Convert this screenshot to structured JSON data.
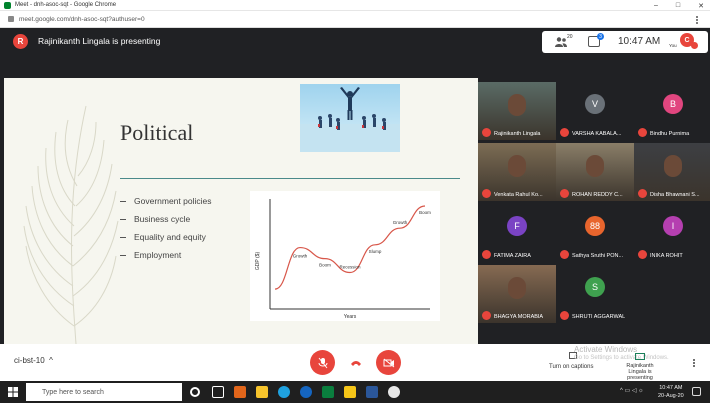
{
  "browser": {
    "tab_title": "Meet - dnh-asoc-sqt - Google Chrome",
    "url": "meet.google.com/dnh-asoc-sqt?authuser=0",
    "window_controls": [
      "–",
      "□",
      "✕"
    ]
  },
  "meet": {
    "presenter_initial": "R",
    "presenter_text": "Rajinikanth Lingala is presenting",
    "people_count": "20",
    "chat_badge": "3",
    "clock": "10:47 AM",
    "you_label": "You",
    "you_initial": "C",
    "meeting_code": "ci-bst-10",
    "meeting_code_chevron": "^",
    "captions_label": "Turn on captions",
    "activate_line1": "Activate Windows",
    "activate_line2": "Go to Settings to activate Windows.",
    "presenting_label": "Rajinikanth Lingala is presenting"
  },
  "slide": {
    "title": "Political",
    "bullets": [
      "Government policies",
      "Business cycle",
      "Equality and equity",
      "Employment"
    ]
  },
  "chart_data": {
    "type": "line",
    "title": "",
    "xlabel": "Years",
    "ylabel": "GDP ($)",
    "x": [
      0,
      1,
      2,
      3,
      4,
      5,
      6
    ],
    "values": [
      1,
      4,
      3.2,
      2.2,
      4.2,
      5.4,
      7
    ],
    "annotations": [
      "Growth",
      "Boom",
      "Recession",
      "Slump",
      "Growth",
      "Boom"
    ],
    "grid": false
  },
  "participants": [
    {
      "name": "Rajinikanth Lingala",
      "type": "video",
      "color": "#5a6b66"
    },
    {
      "name": "VARSHA KABALA...",
      "type": "avatar",
      "initial": "V",
      "color": "#6a7178"
    },
    {
      "name": "Bindhu Purnima",
      "type": "avatar",
      "initial": "B",
      "color": "#e1467f"
    },
    {
      "name": "Venkata Rahul Ko...",
      "type": "video",
      "color": "#7c6c54"
    },
    {
      "name": "ROHAN REDDY C...",
      "type": "video",
      "color": "#8a7e68"
    },
    {
      "name": "Disha Bhawnani S...",
      "type": "photo",
      "color": "#3d3f43"
    },
    {
      "name": "FATIMA ZAIRA",
      "type": "avatar",
      "initial": "F",
      "color": "#7a43c4"
    },
    {
      "name": "Sathya Sruthi PON...",
      "type": "avatar",
      "initial": "88",
      "color": "#e8652d"
    },
    {
      "name": "INIKA ROHIT",
      "type": "avatar",
      "initial": "I",
      "color": "#b53fb0"
    },
    {
      "name": "BHAGYA MORABIA",
      "type": "video",
      "color": "#866a52"
    },
    {
      "name": "SHRUTI AGGARWAL",
      "type": "avatar",
      "initial": "S",
      "color": "#3fa14f"
    }
  ],
  "taskbar": {
    "search_placeholder": "Type here to search",
    "time": "10:47 AM",
    "date": "20-Aug-20"
  },
  "colors": {
    "meet_dark": "#202124",
    "danger": "#e8453c",
    "slide_bg": "#f6f6ef",
    "line": "#d8574a"
  }
}
